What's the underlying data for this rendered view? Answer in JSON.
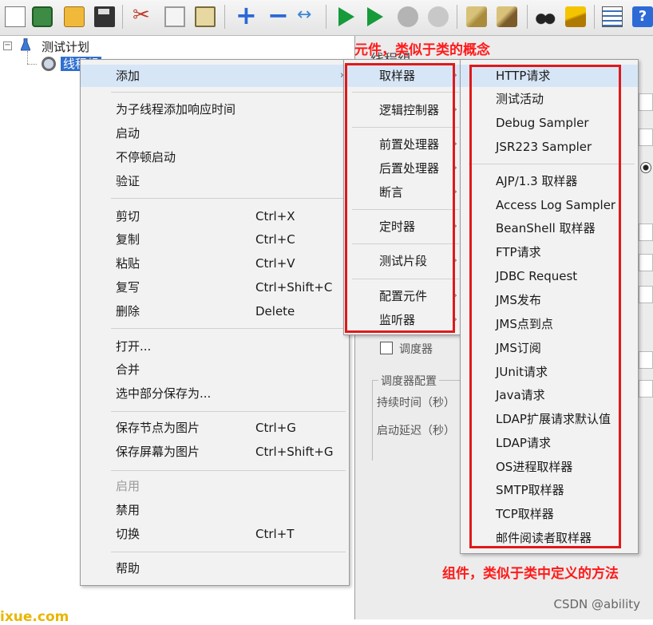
{
  "toolbar": {
    "icons": [
      "new-icon",
      "templates-icon",
      "open-icon",
      "save-icon",
      "cut-icon",
      "copy-icon",
      "paste-icon",
      "expand-icon",
      "collapse-icon",
      "toggle-icon",
      "start-icon",
      "start-no-pauses-icon",
      "stop-icon",
      "shutdown-icon",
      "clear-icon",
      "clear-all-icon",
      "search-icon",
      "reset-search-icon",
      "function-helper-icon",
      "help-icon"
    ],
    "help_glyph": "?"
  },
  "tree": {
    "root_label": "测试计划",
    "child_label": "线程组"
  },
  "right_panel": {
    "title": "线程组",
    "scheduler_label": "调度器",
    "scheduler_config_label": "调度器配置",
    "duration_label": "持续时间（秒）",
    "delay_label": "启动延迟（秒）"
  },
  "context_menu": {
    "items": [
      {
        "label": "添加",
        "shortcut": "",
        "submenu": true
      },
      {
        "label": "为子线程添加响应时间",
        "shortcut": ""
      },
      {
        "label": "启动",
        "shortcut": ""
      },
      {
        "label": "不停顿启动",
        "shortcut": ""
      },
      {
        "label": "验证",
        "shortcut": ""
      },
      {
        "label": "剪切",
        "shortcut": "Ctrl+X"
      },
      {
        "label": "复制",
        "shortcut": "Ctrl+C"
      },
      {
        "label": "粘贴",
        "shortcut": "Ctrl+V"
      },
      {
        "label": "复写",
        "shortcut": "Ctrl+Shift+C"
      },
      {
        "label": "删除",
        "shortcut": "Delete"
      },
      {
        "label": "打开...",
        "shortcut": ""
      },
      {
        "label": "合并",
        "shortcut": ""
      },
      {
        "label": "选中部分保存为...",
        "shortcut": ""
      },
      {
        "label": "保存节点为图片",
        "shortcut": "Ctrl+G"
      },
      {
        "label": "保存屏幕为图片",
        "shortcut": "Ctrl+Shift+G"
      },
      {
        "label": "启用",
        "shortcut": "",
        "disabled": true
      },
      {
        "label": "禁用",
        "shortcut": ""
      },
      {
        "label": "切换",
        "shortcut": "Ctrl+T"
      },
      {
        "label": "帮助",
        "shortcut": ""
      }
    ]
  },
  "add_submenu": {
    "items": [
      "取样器",
      "逻辑控制器",
      "前置处理器",
      "后置处理器",
      "断言",
      "定时器",
      "测试片段",
      "配置元件",
      "监听器"
    ]
  },
  "sampler_submenu": {
    "items": [
      "HTTP请求",
      "测试活动",
      "Debug Sampler",
      "JSR223 Sampler",
      "AJP/1.3 取样器",
      "Access Log Sampler",
      "BeanShell 取样器",
      "FTP请求",
      "JDBC Request",
      "JMS发布",
      "JMS点到点",
      "JMS订阅",
      "JUnit请求",
      "Java请求",
      "LDAP扩展请求默认值",
      "LDAP请求",
      "OS进程取样器",
      "SMTP取样器",
      "TCP取样器",
      "邮件阅读者取样器"
    ]
  },
  "annotations": {
    "top_note": "元件，类似于类的概念",
    "bottom_note": "组件，类似于类中定义的方法",
    "color": "#ff1a1a"
  },
  "watermarks": {
    "bottom_left": "ixue.com",
    "csdn": "CSDN @ability"
  },
  "colors": {
    "menu_bg": "#f2f2f2",
    "highlight": "#d7e6f7",
    "selected_node": "#2f6fd0"
  }
}
